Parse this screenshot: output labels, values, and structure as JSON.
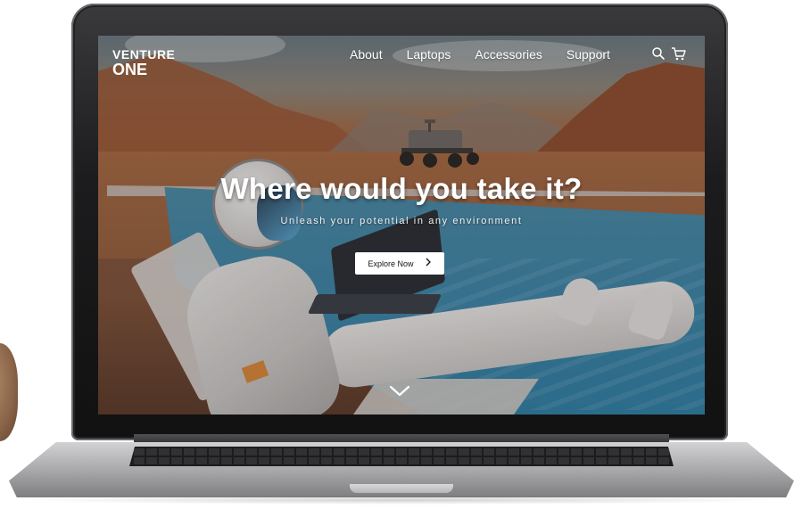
{
  "brand": {
    "line1": "VENTURE",
    "line2": "ONE"
  },
  "nav": {
    "items": [
      {
        "label": "About"
      },
      {
        "label": "Laptops"
      },
      {
        "label": "Accessories"
      },
      {
        "label": "Support"
      }
    ]
  },
  "header_icons": [
    "search-icon",
    "cart-icon"
  ],
  "hero": {
    "headline": "Where would you take it?",
    "subheadline": "Unleash your potential in any environment",
    "cta_label": "Explore Now",
    "cta_icon": "chevron-right-icon",
    "scroll_icon": "chevron-down-icon"
  },
  "colors": {
    "cta_background": "#ffffff",
    "text": "#ffffff",
    "laptop_body": "#a9a9ab"
  }
}
